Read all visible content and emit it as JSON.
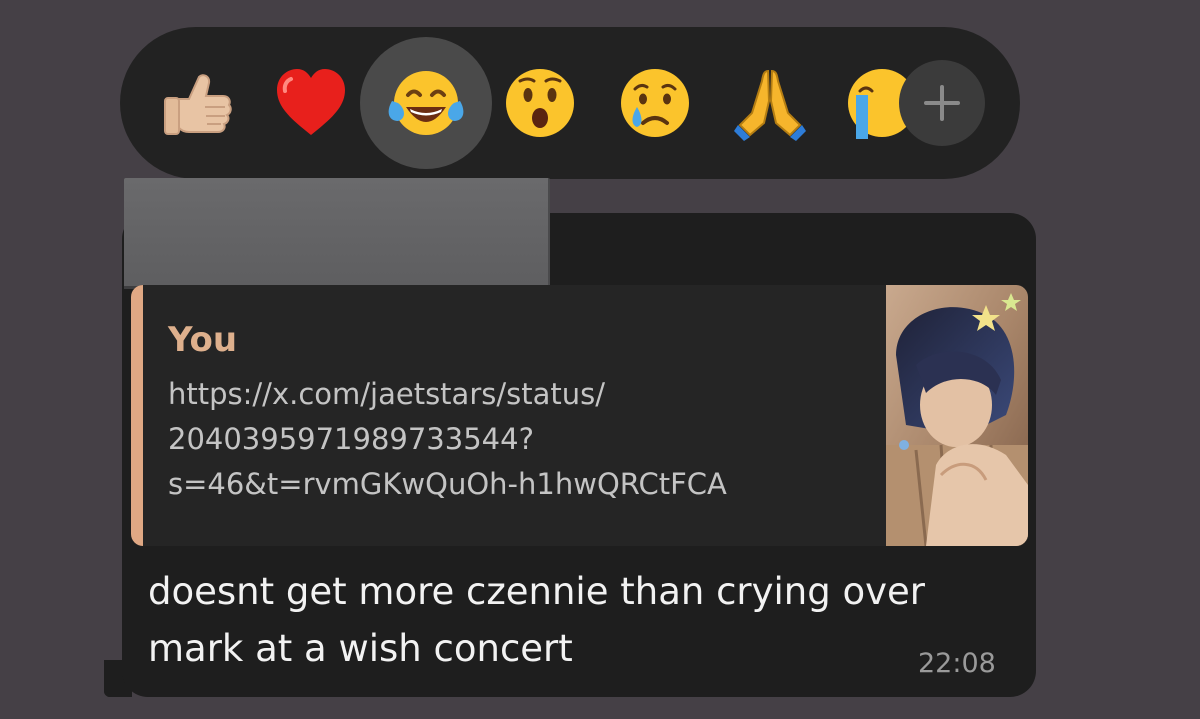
{
  "reaction_bar": {
    "reactions": [
      {
        "name": "thumbs-up",
        "selected": false
      },
      {
        "name": "red-heart",
        "selected": false
      },
      {
        "name": "face-with-tears-of-joy",
        "selected": true
      },
      {
        "name": "face-with-open-mouth",
        "selected": false
      },
      {
        "name": "crying-face",
        "selected": false
      },
      {
        "name": "folded-hands",
        "selected": false
      },
      {
        "name": "loudly-crying-face",
        "selected": false
      }
    ],
    "more_button_icon": "plus-icon"
  },
  "message": {
    "sender_name_redacted": true,
    "quoted_reply": {
      "author": "You",
      "text": "https://x.com/jaetstars/status/\n2040395971989733544?\ns=46&t=rvmGKwQuOh-h1hwQRCtFCA",
      "has_thumbnail": true
    },
    "text": "doesnt get more czennie than crying over\nmark at a wish concert",
    "time": "22:08"
  },
  "colors": {
    "background": "#454046",
    "bubble": "#1e1e1e",
    "quote_accent": "#e0a884",
    "quote_author": "#deb08d"
  }
}
